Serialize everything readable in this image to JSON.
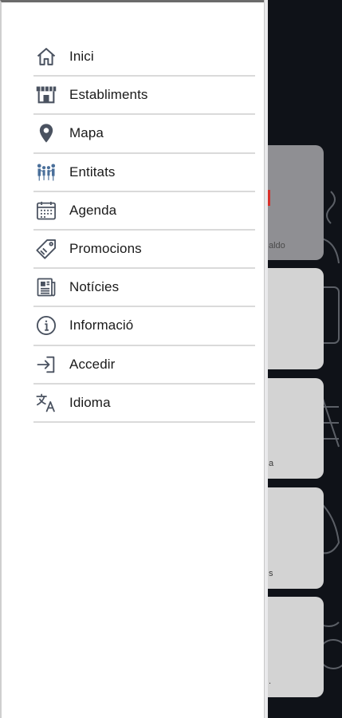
{
  "menu": {
    "items": [
      {
        "label": "Inici",
        "icon": "home-icon"
      },
      {
        "label": "Establiments",
        "icon": "storefront-icon"
      },
      {
        "label": "Mapa",
        "icon": "map-pin-icon"
      },
      {
        "label": "Entitats",
        "icon": "people-icon"
      },
      {
        "label": "Agenda",
        "icon": "calendar-icon"
      },
      {
        "label": "Promocions",
        "icon": "tag-icon"
      },
      {
        "label": "Notícies",
        "icon": "newspaper-icon"
      },
      {
        "label": "Informació",
        "icon": "info-icon"
      },
      {
        "label": "Accedir",
        "icon": "login-icon"
      },
      {
        "label": "Idioma",
        "icon": "translate-icon"
      }
    ]
  },
  "background": {
    "card_fragment_1": "aldo",
    "card_fragment_3": "a",
    "card_fragment_4": "s",
    "card_fragment_5": "."
  },
  "colors": {
    "drawer_bg": "#ffffff",
    "app_bg": "#0f1218",
    "card_bg": "#d3d3d3",
    "icon": "#4a5260",
    "accent_red": "#d6312b"
  }
}
